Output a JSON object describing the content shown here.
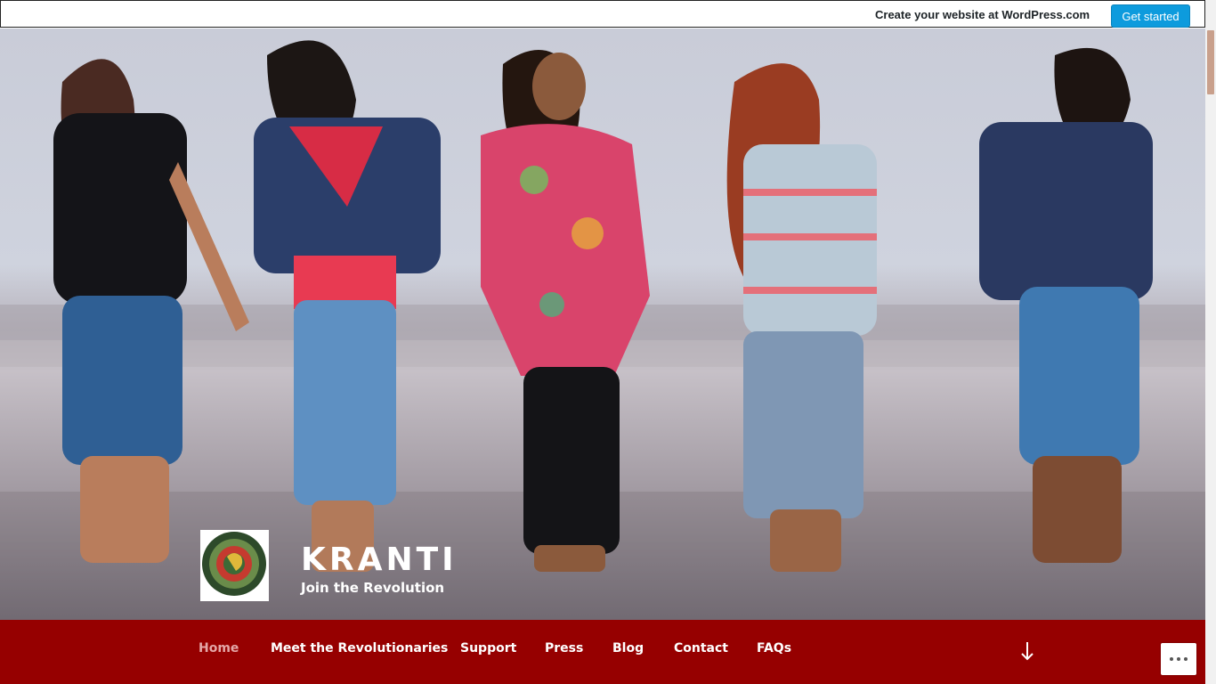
{
  "topbar": {
    "create_text": "Create your website at WordPress.com",
    "cta_label": "Get started"
  },
  "site": {
    "title": "KRANTI",
    "tagline": "Join the Revolution"
  },
  "nav": {
    "items": [
      "Home",
      "Meet the Revolutionaries",
      "Support",
      "Press",
      "Blog",
      "Contact",
      "FAQs"
    ],
    "active": "Home"
  },
  "colors": {
    "nav_bg": "#960000",
    "cta_bg": "#0d9bdd",
    "active_nav": "#e4a7a7"
  },
  "icons": {
    "scroll": "arrow-down-icon",
    "more": "ellipsis-icon"
  }
}
